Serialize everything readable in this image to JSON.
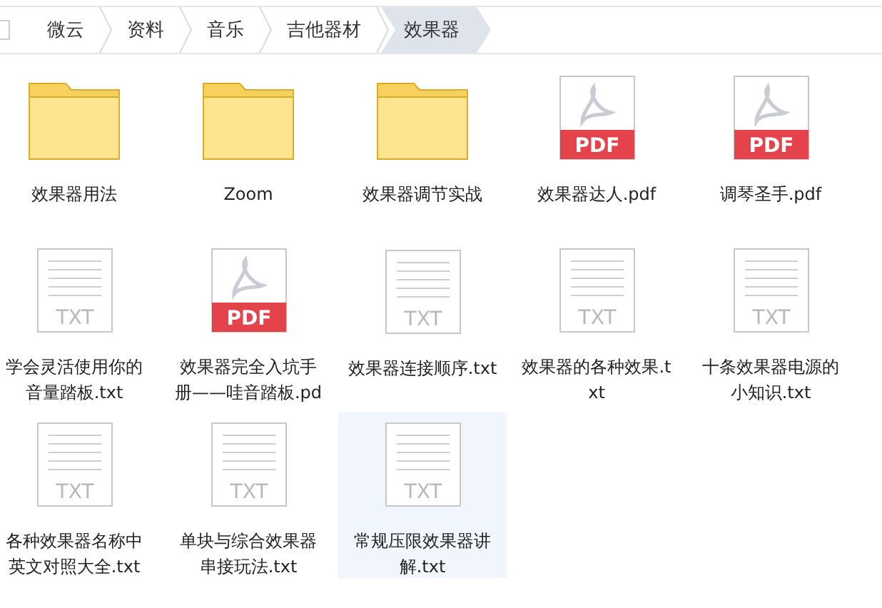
{
  "breadcrumb": [
    {
      "label": "微云",
      "selected": false
    },
    {
      "label": "资料",
      "selected": false
    },
    {
      "label": "音乐",
      "selected": false
    },
    {
      "label": "吉他器材",
      "selected": false
    },
    {
      "label": "效果器",
      "selected": true
    }
  ],
  "files": [
    {
      "kind": "folder",
      "name": "效果器用法",
      "selected": false
    },
    {
      "kind": "folder",
      "name": "Zoom",
      "selected": false
    },
    {
      "kind": "folder",
      "name": "效果器调节实战",
      "selected": false
    },
    {
      "kind": "pdf",
      "badge": "PDF",
      "name": "效果器达人.pdf",
      "selected": false
    },
    {
      "kind": "pdf",
      "badge": "PDF",
      "name": "调琴圣手.pdf",
      "selected": false
    },
    {
      "kind": "txt",
      "badge": "TXT",
      "name": "学会灵活使用你的音量踏板.txt",
      "selected": false
    },
    {
      "kind": "pdf",
      "badge": "PDF",
      "name": "效果器完全入坑手册——哇音踏板.pd",
      "selected": false
    },
    {
      "kind": "txt",
      "badge": "TXT",
      "name": "效果器连接顺序.txt",
      "selected": false
    },
    {
      "kind": "txt",
      "badge": "TXT",
      "name": "效果器的各种效果.txt",
      "selected": false
    },
    {
      "kind": "txt",
      "badge": "TXT",
      "name": "十条效果器电源的小知识.txt",
      "selected": false
    },
    {
      "kind": "txt",
      "badge": "TXT",
      "name": "各种效果器名称中英文对照大全.txt",
      "selected": false
    },
    {
      "kind": "txt",
      "badge": "TXT",
      "name": "单块与综合效果器串接玩法.txt",
      "selected": false
    },
    {
      "kind": "txt",
      "badge": "TXT",
      "name": "常规压限效果器讲解.txt",
      "selected": true
    }
  ]
}
